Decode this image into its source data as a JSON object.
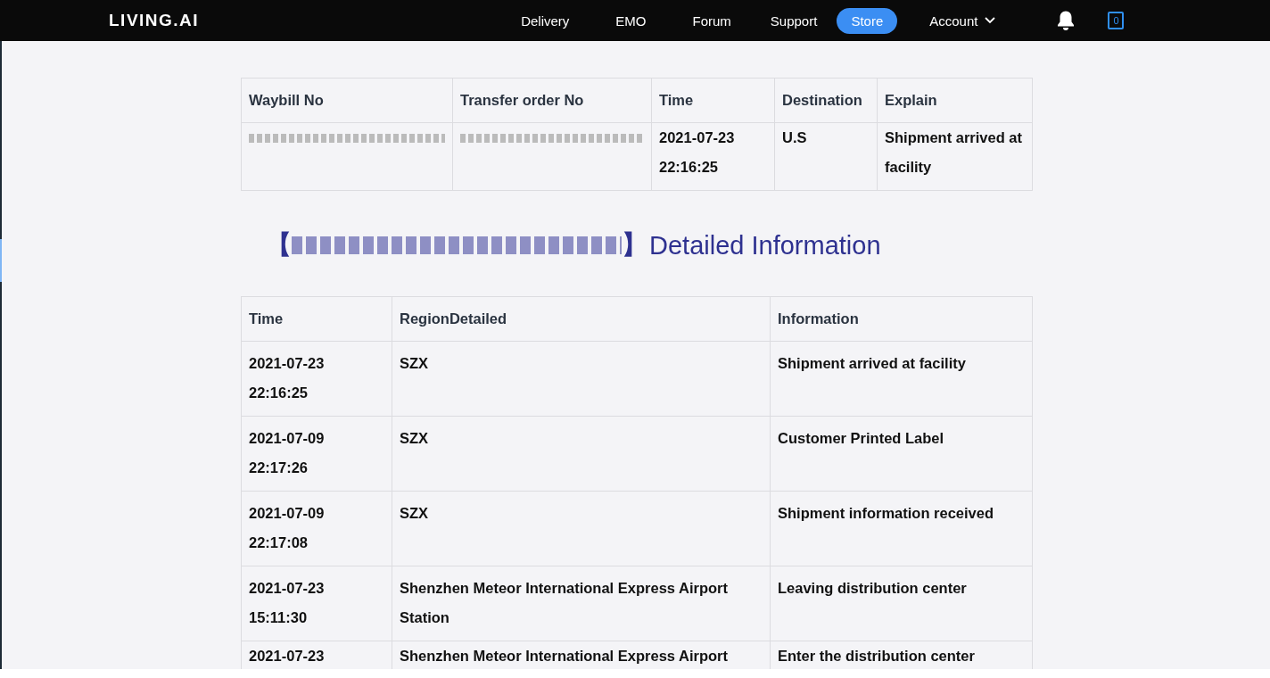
{
  "header": {
    "logo": "LIVING.AI",
    "nav": [
      {
        "label": "Delivery",
        "selected": false
      },
      {
        "label": "EMO",
        "selected": false
      },
      {
        "label": "Forum",
        "selected": false
      },
      {
        "label": "Support",
        "selected": false
      },
      {
        "label": "Store",
        "selected": true
      },
      {
        "label": "Account",
        "selected": false,
        "kind": "dropdown"
      }
    ],
    "cart_count": "0"
  },
  "summary_table": {
    "columns": [
      "Waybill No",
      "Transfer order No",
      "Time",
      "Destination",
      "Explain"
    ],
    "rows": [
      {
        "cells": [
          {
            "kind": "redacted"
          },
          {
            "kind": "redacted"
          },
          {
            "kind": "text",
            "text": "2021-07-23 22:16:25"
          },
          {
            "kind": "text",
            "text": "U.S"
          },
          {
            "kind": "text",
            "text": "Shipment arrived at facility"
          }
        ]
      }
    ]
  },
  "detail_heading": {
    "bracket_open": "【",
    "bracket_close": "】",
    "title": "Detailed Information"
  },
  "detail_table": {
    "columns": [
      "Time",
      "RegionDetailed",
      "Information"
    ],
    "rows": [
      {
        "time": "2021-07-23 22:16:25",
        "region": "SZX",
        "information": "Shipment arrived at facility"
      },
      {
        "time": "2021-07-09 22:17:26",
        "region": "SZX",
        "information": "Customer Printed Label"
      },
      {
        "time": "2021-07-09 22:17:08",
        "region": "SZX",
        "information": "Shipment information received"
      },
      {
        "time": "2021-07-23 15:11:30",
        "region": "Shenzhen Meteor International Express Airport Station",
        "information": "Leaving distribution center"
      },
      {
        "time": "2021-07-23",
        "region": "Shenzhen Meteor International Express Airport",
        "information": "Enter the distribution center"
      }
    ]
  }
}
